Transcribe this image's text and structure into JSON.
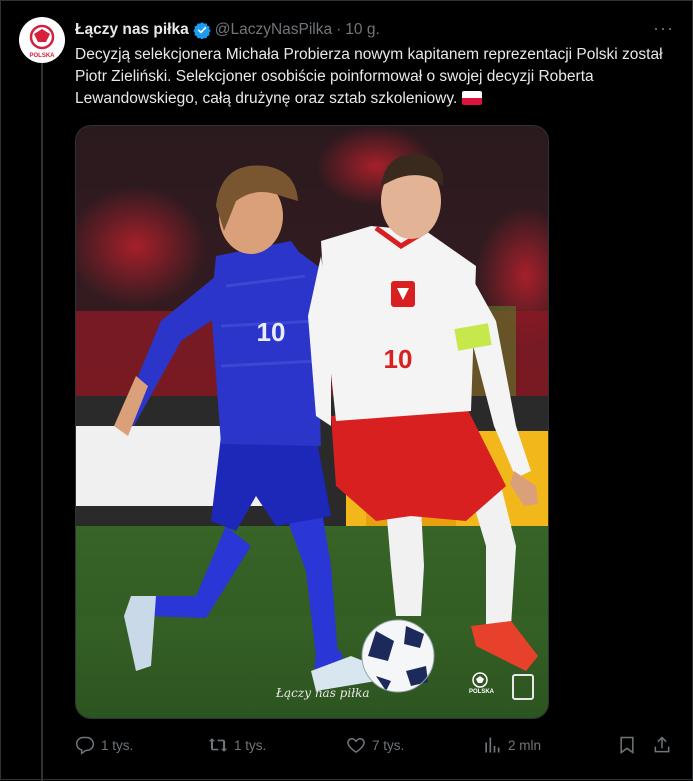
{
  "tweet": {
    "author_name": "Łączy nas piłka",
    "handle": "@LaczyNasPilka",
    "separator": "·",
    "time": "10 g.",
    "more_label": "···",
    "text": "Decyzją selekcjonera Michała Probierza nowym kapitanem reprezentacji Polski został Piotr Zieliński. Selekcjoner osobiście poinformował o swojej decyzji Roberta Lewandowskiego, całą drużynę oraz sztab szkoleniowy.",
    "text_flag": "poland-flag-emoji",
    "avatar_label": "POLSKA"
  },
  "media": {
    "watermark": "Łączy nas piłka",
    "logo_label": "POLSKA",
    "player_left_number": "10",
    "player_right_number": "10"
  },
  "actions": {
    "reply_count": "1 tys.",
    "retweet_count": "1 tys.",
    "like_count": "7 tys.",
    "views_count": "2 mln"
  },
  "icons": {
    "verified": "verified-badge-icon",
    "reply": "reply-icon",
    "retweet": "retweet-icon",
    "like": "heart-icon",
    "views": "views-chart-icon",
    "bookmark": "bookmark-icon",
    "share": "share-icon"
  },
  "colors": {
    "background": "#000000",
    "text": "#e7e9ea",
    "muted": "#71767b",
    "verified": "#1d9bf0",
    "poland_red": "#dc143c",
    "croatia_blue": "#2b35c9"
  }
}
